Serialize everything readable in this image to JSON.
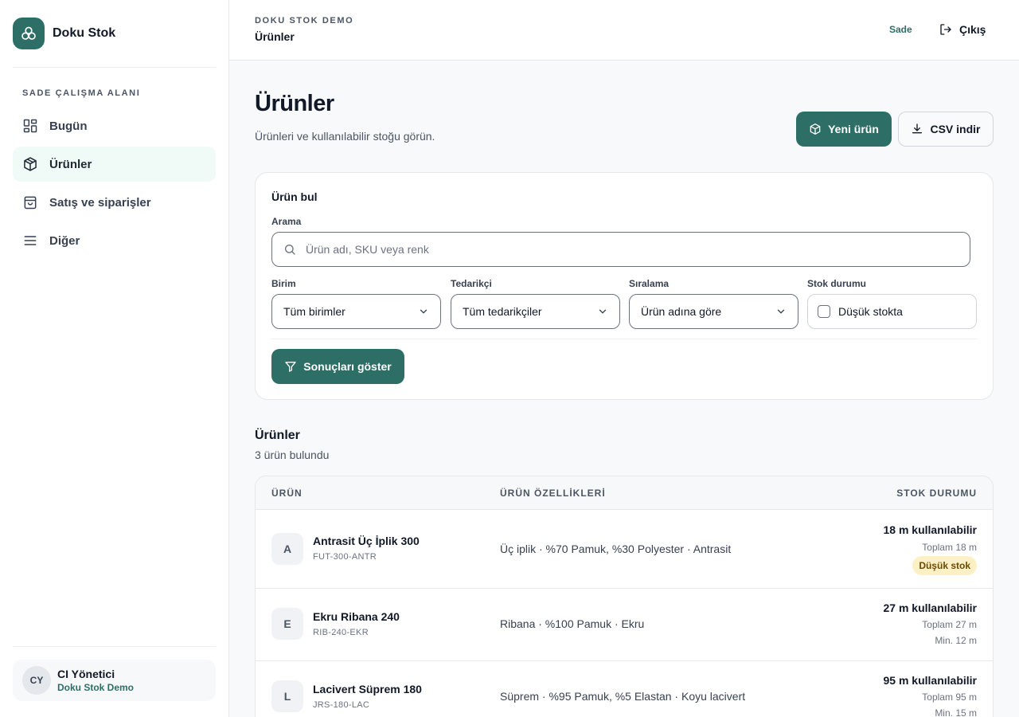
{
  "brand": {
    "name": "Doku Stok",
    "icon": "fabric-logo-icon",
    "color": "#2d6f66"
  },
  "sidebar": {
    "section_label": "SADE ÇALIŞMA ALANI",
    "items": [
      {
        "label": "Bugün",
        "icon": "dashboard-grid-icon",
        "active": false
      },
      {
        "label": "Ürünler",
        "icon": "package-icon",
        "active": true
      },
      {
        "label": "Satış ve siparişler",
        "icon": "shopping-bag-icon",
        "active": false
      },
      {
        "label": "Diğer",
        "icon": "menu-icon",
        "active": false
      }
    ]
  },
  "user": {
    "initials": "CY",
    "name": "CI Yönetici",
    "org": "Doku Stok Demo"
  },
  "topbar": {
    "kicker": "DOKU STOK DEMO",
    "title": "Ürünler",
    "mode": "Sade",
    "logout_label": "Çıkış"
  },
  "page": {
    "title": "Ürünler",
    "subtitle": "Ürünleri ve kullanılabilir stoğu görün.",
    "new_button": "Yeni ürün",
    "csv_button": "CSV indir"
  },
  "filters": {
    "title": "Ürün bul",
    "search_label": "Arama",
    "search_placeholder": "Ürün adı, SKU veya renk",
    "search_value": "",
    "unit_label": "Birim",
    "unit_value": "Tüm birimler",
    "supplier_label": "Tedarikçi",
    "supplier_value": "Tüm tedarikçiler",
    "sort_label": "Sıralama",
    "sort_value": "Ürün adına göre",
    "stock_label": "Stok durumu",
    "low_stock_label": "Düşük stokta",
    "low_stock_checked": false,
    "submit": "Sonuçları göster"
  },
  "list": {
    "title": "Ürünler",
    "count": "3 ürün bulundu",
    "columns": {
      "product": "ÜRÜN",
      "attributes": "ÜRÜN ÖZELLİKLERİ",
      "stock": "STOK DURUMU"
    },
    "rows": [
      {
        "initial": "A",
        "name": "Antrasit Üç İplik 300",
        "sku": "FUT-300-ANTR",
        "attributes": "Üç iplik · %70 Pamuk, %30 Polyester · Antrasit",
        "available": "18 m kullanılabilir",
        "total": "Toplam 18 m",
        "badge": "Düşük stok"
      },
      {
        "initial": "E",
        "name": "Ekru Ribana 240",
        "sku": "RIB-240-EKR",
        "attributes": "Ribana · %100 Pamuk · Ekru",
        "available": "27 m kullanılabilir",
        "total": "Toplam 27 m",
        "min": "Min. 12 m"
      },
      {
        "initial": "L",
        "name": "Lacivert Süprem 180",
        "sku": "JRS-180-LAC",
        "attributes": "Süprem · %95 Pamuk, %5 Elastan · Koyu lacivert",
        "available": "95 m kullanılabilir",
        "total": "Toplam 95 m",
        "min": "Min. 15 m"
      }
    ]
  }
}
